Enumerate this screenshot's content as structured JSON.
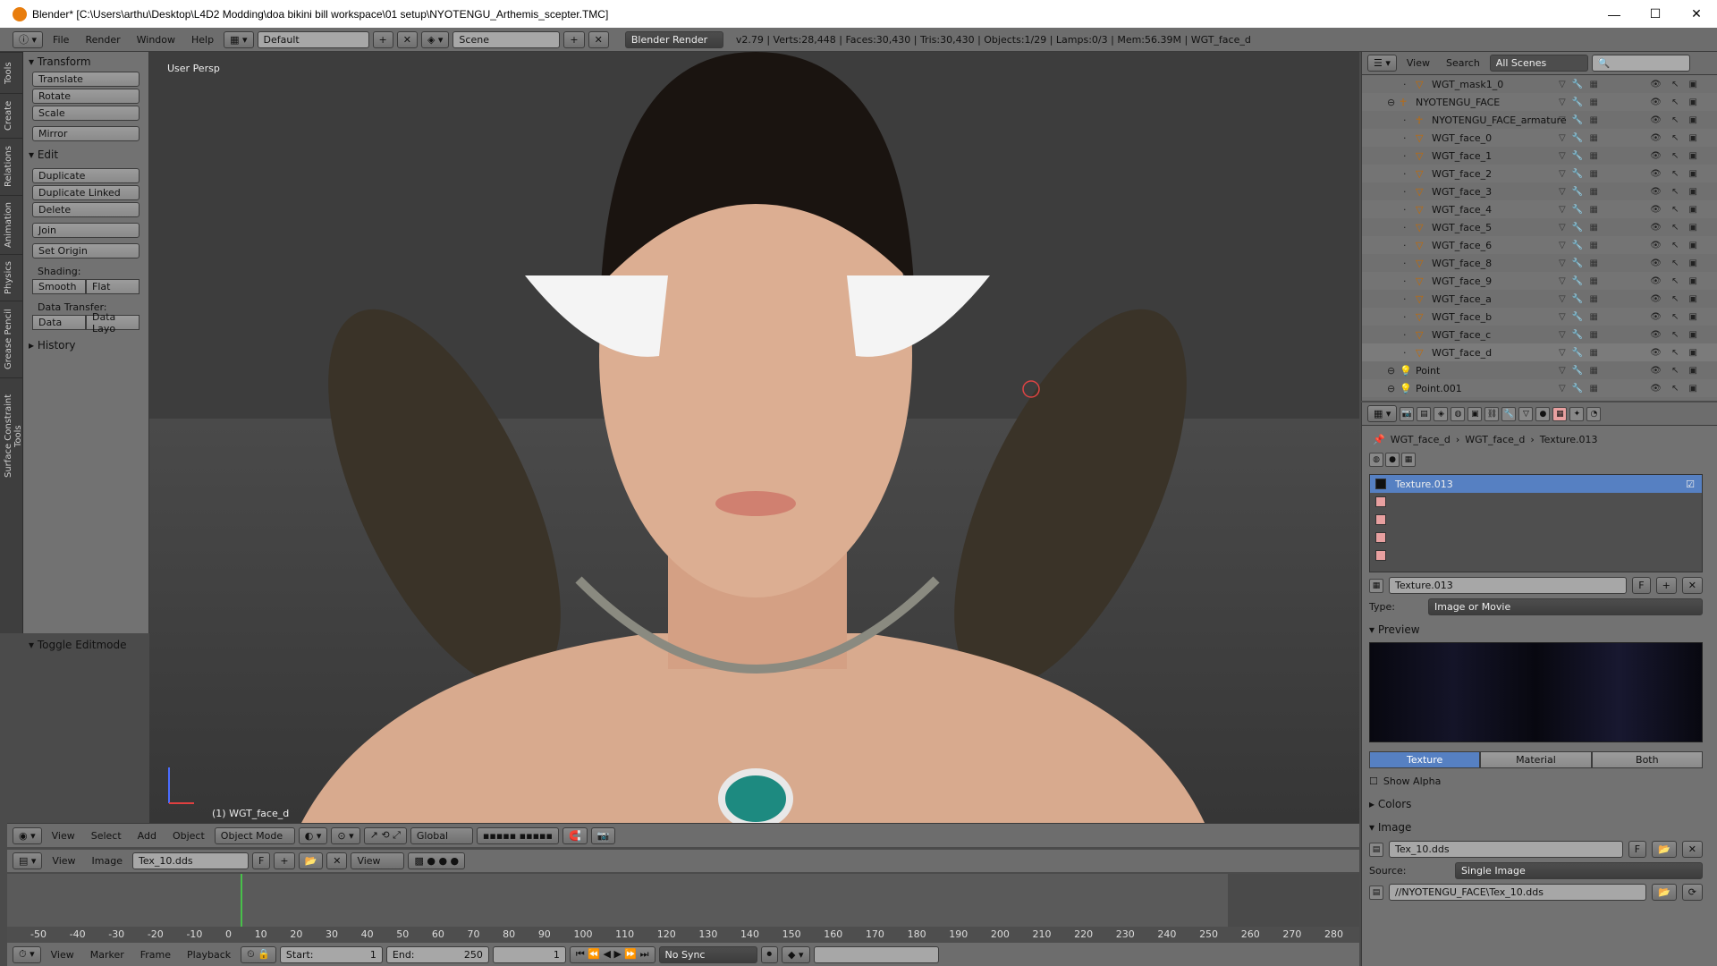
{
  "window": {
    "title": "Blender* [C:\\Users\\arthu\\Desktop\\L4D2 Modding\\doa bikini bill workspace\\01 setup\\NYOTENGU_Arthemis_scepter.TMC]",
    "min": "—",
    "max": "☐",
    "close": "✕"
  },
  "menubar": {
    "items": [
      "File",
      "Render",
      "Window",
      "Help"
    ],
    "layout": "Default",
    "scene": "Scene",
    "engine": "Blender Render",
    "stats": "v2.79 | Verts:28,448 | Faces:30,430 | Tris:30,430 | Objects:1/29 | Lamps:0/3 | Mem:56.39M | WGT_face_d"
  },
  "lefttabs": [
    "Tools",
    "Create",
    "Relations",
    "Animation",
    "Physics",
    "Grease Pencil",
    "Surface Constraint Tools"
  ],
  "toolshelf": {
    "transform": "Transform",
    "translate": "Translate",
    "rotate": "Rotate",
    "scale": "Scale",
    "mirror": "Mirror",
    "edit": "Edit",
    "duplicate": "Duplicate",
    "duplicate_linked": "Duplicate Linked",
    "delete": "Delete",
    "join": "Join",
    "set_origin": "Set Origin",
    "shading": "Shading:",
    "smooth": "Smooth",
    "flat": "Flat",
    "data_transfer": "Data Transfer:",
    "data": "Data",
    "data_layo": "Data Layo",
    "history": "History",
    "toggle_editmode": "Toggle Editmode"
  },
  "viewport": {
    "label": "User Persp",
    "object_label": "(1) WGT_face_d"
  },
  "vtoolbar": {
    "view": "View",
    "select": "Select",
    "add": "Add",
    "object": "Object",
    "mode": "Object Mode",
    "orientation": "Global"
  },
  "itoolbar": {
    "view": "View",
    "image": "Image",
    "image_name": "Tex_10.dds",
    "f": "F",
    "view2": "View"
  },
  "timeline": {
    "ticks": [
      "-50",
      "-40",
      "-30",
      "-20",
      "-10",
      "0",
      "10",
      "20",
      "30",
      "40",
      "50",
      "60",
      "70",
      "80",
      "90",
      "100",
      "110",
      "120",
      "130",
      "140",
      "150",
      "160",
      "170",
      "180",
      "190",
      "200",
      "210",
      "220",
      "230",
      "240",
      "250",
      "260",
      "270",
      "280"
    ]
  },
  "ttoolbar": {
    "view": "View",
    "marker": "Marker",
    "frame": "Frame",
    "playback": "Playback",
    "start": "Start:",
    "start_val": "1",
    "end": "End:",
    "end_val": "250",
    "current": "1",
    "sync": "No Sync"
  },
  "outliner": {
    "view": "View",
    "search": "Search",
    "scenes": "All Scenes",
    "rows": [
      {
        "name": "WGT_mask1_0",
        "type": "mesh",
        "indent": 2
      },
      {
        "name": "NYOTENGU_FACE",
        "type": "armature",
        "indent": 1
      },
      {
        "name": "NYOTENGU_FACE_armature",
        "type": "armature",
        "indent": 2
      },
      {
        "name": "WGT_face_0",
        "type": "mesh",
        "indent": 2
      },
      {
        "name": "WGT_face_1",
        "type": "mesh",
        "indent": 2
      },
      {
        "name": "WGT_face_2",
        "type": "mesh",
        "indent": 2
      },
      {
        "name": "WGT_face_3",
        "type": "mesh",
        "indent": 2
      },
      {
        "name": "WGT_face_4",
        "type": "mesh",
        "indent": 2
      },
      {
        "name": "WGT_face_5",
        "type": "mesh",
        "indent": 2
      },
      {
        "name": "WGT_face_6",
        "type": "mesh",
        "indent": 2
      },
      {
        "name": "WGT_face_8",
        "type": "mesh",
        "indent": 2
      },
      {
        "name": "WGT_face_9",
        "type": "mesh",
        "indent": 2
      },
      {
        "name": "WGT_face_a",
        "type": "mesh",
        "indent": 2
      },
      {
        "name": "WGT_face_b",
        "type": "mesh",
        "indent": 2
      },
      {
        "name": "WGT_face_c",
        "type": "mesh",
        "indent": 2
      },
      {
        "name": "WGT_face_d",
        "type": "mesh",
        "indent": 2
      },
      {
        "name": "Point",
        "type": "lamp",
        "indent": 1
      },
      {
        "name": "Point.001",
        "type": "lamp",
        "indent": 1
      }
    ]
  },
  "properties": {
    "bc1": "WGT_face_d",
    "bc2": "WGT_face_d",
    "bc3": "Texture.013",
    "slot": "Texture.013",
    "tex_name": "Texture.013",
    "f": "F",
    "type_label": "Type:",
    "type_value": "Image or Movie",
    "preview": "Preview",
    "tab_texture": "Texture",
    "tab_material": "Material",
    "tab_both": "Both",
    "show_alpha": "Show Alpha",
    "colors": "Colors",
    "image": "Image",
    "image_name": "Tex_10.dds",
    "source_label": "Source:",
    "source_value": "Single Image",
    "path": "//NYOTENGU_FACE\\Tex_10.dds"
  }
}
